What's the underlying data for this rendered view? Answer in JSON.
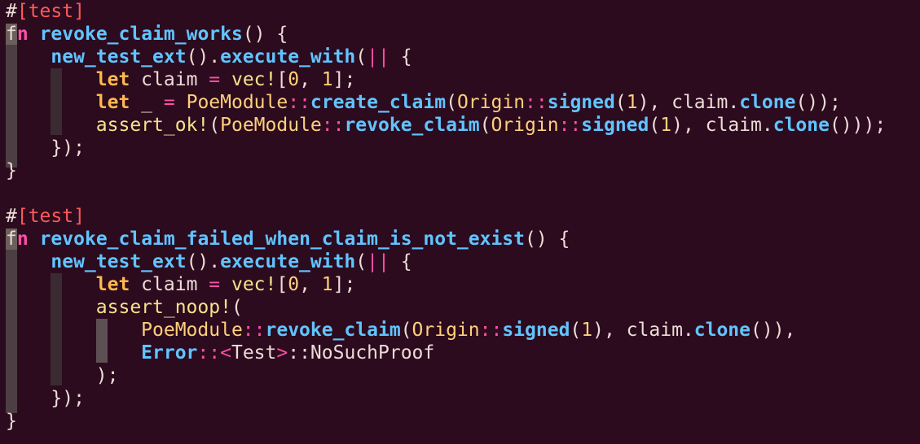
{
  "code": {
    "lines": [
      [
        "#",
        "[test]"
      ],
      [
        "f",
        "n",
        " ",
        "revoke_claim_works",
        "() {"
      ],
      [
        "    ",
        "new_test_ext",
        "().",
        "execute_with",
        "(",
        "||",
        " {"
      ],
      [
        "        ",
        "let",
        " claim ",
        "=",
        " vec!",
        "[",
        "0",
        ", ",
        "1",
        "];"
      ],
      [
        "        ",
        "let",
        " _ ",
        "=",
        " ",
        "PoeModule",
        "::",
        "create_claim",
        "(",
        "Origin",
        "::",
        "signed",
        "(",
        "1",
        "), claim.",
        "clone",
        "());"
      ],
      [
        "        ",
        "assert_ok!",
        "(",
        "PoeModule",
        "::",
        "revoke_claim",
        "(",
        "Origin",
        "::",
        "signed",
        "(",
        "1",
        "), claim.",
        "clone",
        "()));"
      ],
      [
        "    ",
        "});"
      ],
      [
        "}"
      ],
      [
        ""
      ],
      [
        "#",
        "[test]"
      ],
      [
        "f",
        "n",
        " ",
        "revoke_claim_failed_when_claim_is_not_exist",
        "() {"
      ],
      [
        "    ",
        "new_test_ext",
        "().",
        "execute_with",
        "(",
        "||",
        " {"
      ],
      [
        "        ",
        "let",
        " claim ",
        "=",
        " vec!",
        "[",
        "0",
        ", ",
        "1",
        "];"
      ],
      [
        "        ",
        "assert_noop!",
        "("
      ],
      [
        "            ",
        "PoeModule",
        "::",
        "revoke_claim",
        "(",
        "Origin",
        "::",
        "signed",
        "(",
        "1",
        "), claim.",
        "clone",
        "()),"
      ],
      [
        "            ",
        "Error",
        "::",
        "<",
        "Test",
        ">",
        "::NoSuchProof"
      ],
      [
        "        ",
        ");"
      ],
      [
        "    ",
        "});"
      ],
      [
        "}"
      ]
    ],
    "classes": [
      [
        "attr-hash",
        "attr"
      ],
      [
        "cursor-f",
        "kw-fn",
        "plain",
        "fname",
        "plain"
      ],
      [
        "plain",
        "call",
        "plain",
        "call",
        "plain",
        "op",
        "plain"
      ],
      [
        "plain",
        "let",
        "plain",
        "op",
        "macro",
        "plain",
        "num",
        "plain",
        "num",
        "plain"
      ],
      [
        "plain",
        "let",
        "plain",
        "op",
        "plain",
        "ty",
        "op",
        "call",
        "plain",
        "ty",
        "op",
        "call",
        "plain",
        "num",
        "plain",
        "call",
        "plain"
      ],
      [
        "plain",
        "macro",
        "plain",
        "ty",
        "op",
        "call",
        "plain",
        "ty",
        "op",
        "call",
        "plain",
        "num",
        "plain",
        "call",
        "plain"
      ],
      [
        "plain",
        "plain"
      ],
      [
        "plain"
      ],
      [
        "plain"
      ],
      [
        "attr-hash",
        "attr"
      ],
      [
        "cursor-f",
        "kw-fn",
        "plain",
        "fname",
        "plain"
      ],
      [
        "plain",
        "call",
        "plain",
        "call",
        "plain",
        "op",
        "plain"
      ],
      [
        "plain",
        "let",
        "plain",
        "op",
        "macro",
        "plain",
        "num",
        "plain",
        "num",
        "plain"
      ],
      [
        "plain",
        "macro",
        "plain"
      ],
      [
        "plain",
        "ty",
        "op",
        "call",
        "plain",
        "ty",
        "op",
        "call",
        "plain",
        "num",
        "plain",
        "call",
        "plain"
      ],
      [
        "plain",
        "fname",
        "op",
        "op",
        "plain",
        "op",
        "plain"
      ],
      [
        "plain",
        "plain"
      ],
      [
        "plain",
        "plain"
      ],
      [
        "plain"
      ]
    ]
  }
}
